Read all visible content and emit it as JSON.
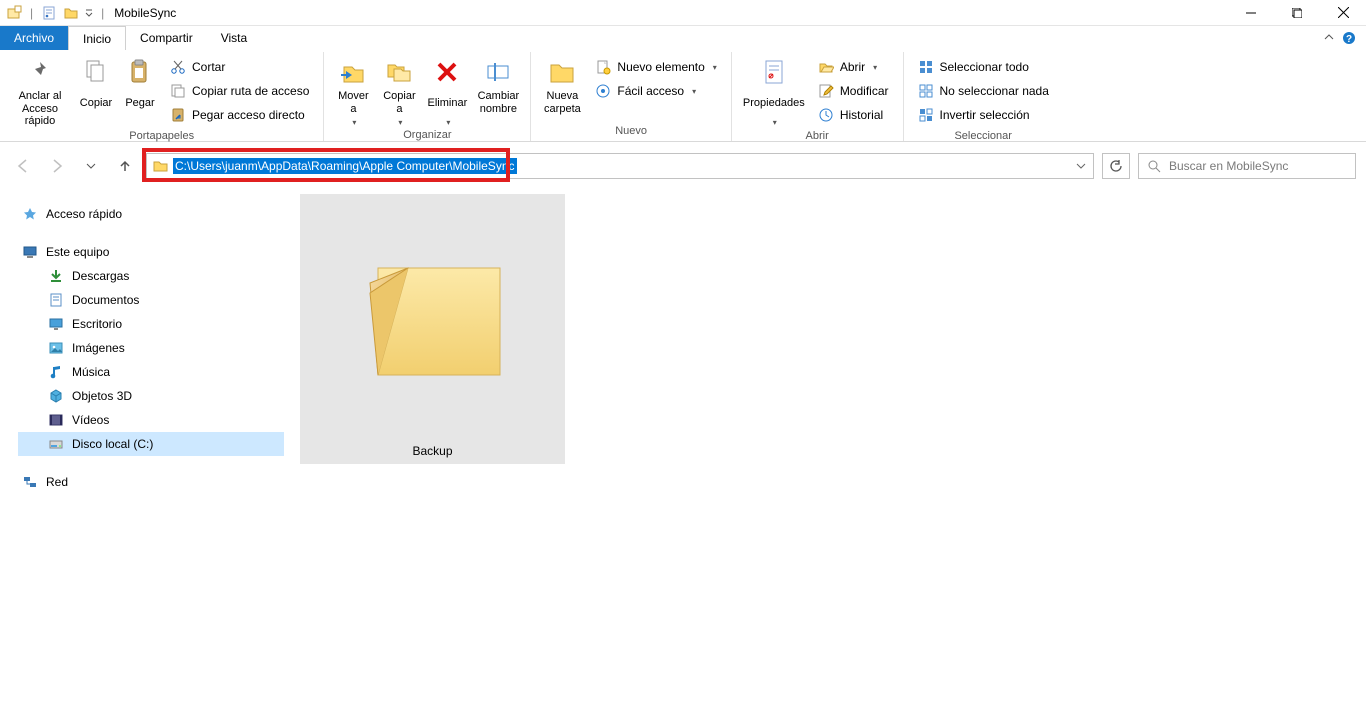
{
  "window": {
    "title": "MobileSync"
  },
  "tabs": {
    "file": "Archivo",
    "home": "Inicio",
    "share": "Compartir",
    "view": "Vista"
  },
  "ribbon": {
    "pin": "Anclar al\nAcceso rápido",
    "copy": "Copiar",
    "paste": "Pegar",
    "cut": "Cortar",
    "copy_path": "Copiar ruta de acceso",
    "paste_shortcut": "Pegar acceso directo",
    "clipboard_group": "Portapapeles",
    "move_to": "Mover\na",
    "copy_to": "Copiar\na",
    "delete": "Eliminar",
    "rename": "Cambiar\nnombre",
    "organize_group": "Organizar",
    "new_folder": "Nueva\ncarpeta",
    "new_item": "Nuevo elemento",
    "easy_access": "Fácil acceso",
    "new_group": "Nuevo",
    "properties": "Propiedades",
    "open": "Abrir",
    "edit": "Modificar",
    "history": "Historial",
    "open_group": "Abrir",
    "select_all": "Seleccionar todo",
    "select_none": "No seleccionar nada",
    "invert_selection": "Invertir selección",
    "select_group": "Seleccionar"
  },
  "address": {
    "path": "C:\\Users\\juanm\\AppData\\Roaming\\Apple Computer\\MobileSync"
  },
  "search": {
    "placeholder": "Buscar en MobileSync"
  },
  "sidebar": {
    "quick_access": "Acceso rápido",
    "this_pc": "Este equipo",
    "downloads": "Descargas",
    "documents": "Documentos",
    "desktop": "Escritorio",
    "pictures": "Imágenes",
    "music": "Música",
    "objects3d": "Objetos 3D",
    "videos": "Vídeos",
    "local_disk": "Disco local (C:)",
    "network": "Red"
  },
  "content": {
    "items": [
      {
        "name": "Backup"
      }
    ]
  }
}
